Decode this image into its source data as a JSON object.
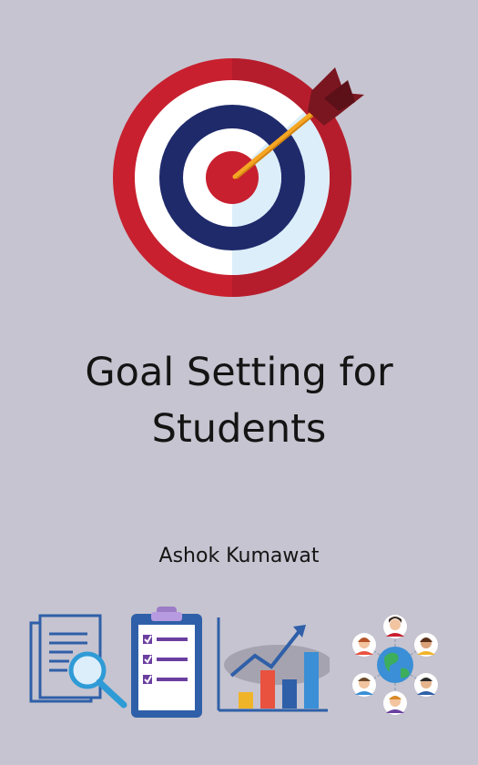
{
  "cover": {
    "title_line1": "Goal Setting for",
    "title_line2": "Students",
    "author": "Ashok Kumawat"
  },
  "colors": {
    "background": "#c6c4d0",
    "target_red": "#c8202f",
    "target_navy": "#1f2a6b",
    "target_white": "#ffffff",
    "target_light_blue": "#dceefa",
    "arrow_shaft": "#f5a623",
    "arrow_fletching": "#7a1620",
    "icon_blue": "#2f5fa8",
    "icon_purple": "#6b3fa0"
  },
  "icons": [
    "target-icon",
    "document-search-icon",
    "checklist-clipboard-icon",
    "growth-chart-icon",
    "global-network-icon"
  ]
}
